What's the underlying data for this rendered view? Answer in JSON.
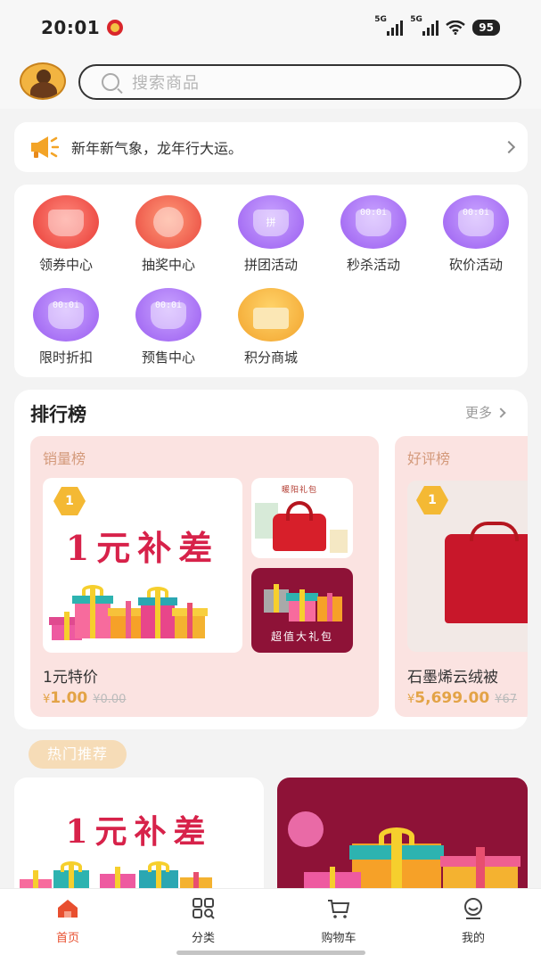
{
  "status": {
    "time": "20:01",
    "signal1": "5G",
    "signal2": "5G",
    "battery": "95"
  },
  "search": {
    "placeholder": "搜索商品"
  },
  "notice": {
    "text": "新年新气象，龙年行大运。"
  },
  "grid": [
    {
      "label": "领券中心",
      "icon": "coupon-icon",
      "color": "red",
      "overlay": ""
    },
    {
      "label": "抽奖中心",
      "icon": "lottery-wheel-icon",
      "color": "orange",
      "overlay": ""
    },
    {
      "label": "拼团活动",
      "icon": "group-buy-bag-icon",
      "color": "purple",
      "overlay": "拼"
    },
    {
      "label": "秒杀活动",
      "icon": "flash-sale-timer-icon",
      "color": "purple",
      "overlay": "00:0i"
    },
    {
      "label": "砍价活动",
      "icon": "bargain-timer-icon",
      "color": "purple",
      "overlay": "00:0i"
    },
    {
      "label": "限时折扣",
      "icon": "limited-discount-timer-icon",
      "color": "purple",
      "overlay": "00:0i"
    },
    {
      "label": "预售中心",
      "icon": "presale-timer-icon",
      "color": "purple",
      "overlay": "00:0i"
    },
    {
      "label": "积分商城",
      "icon": "points-mall-icon",
      "color": "yellow",
      "overlay": ""
    }
  ],
  "ranking": {
    "title": "排行榜",
    "more": "更多",
    "panels": [
      {
        "title": "销量榜",
        "badge": "1",
        "promo": "1元补差",
        "small_caption_top": "暖阳礼包",
        "small_caption_bottom": "超值大礼包",
        "product_name": "1元特价",
        "currency": "¥",
        "price": "1.00",
        "old_price": "¥0.00"
      },
      {
        "title": "好评榜",
        "badge": "1",
        "product_name": "石墨烯云绒被",
        "currency": "¥",
        "price": "5,699.00",
        "old_price": "¥67"
      }
    ]
  },
  "hot": {
    "tag": "热门推荐",
    "left_promo": "1元补差"
  },
  "tabs": [
    {
      "label": "首页",
      "icon": "home-icon",
      "active": true
    },
    {
      "label": "分类",
      "icon": "category-grid-icon",
      "active": false
    },
    {
      "label": "购物车",
      "icon": "cart-icon",
      "active": false
    },
    {
      "label": "我的",
      "icon": "profile-icon",
      "active": false
    }
  ],
  "colors": {
    "accent": "#e84f2f",
    "price": "#e3a346",
    "promo_red": "#d7224a",
    "panel_bg": "#fbe3e1"
  }
}
